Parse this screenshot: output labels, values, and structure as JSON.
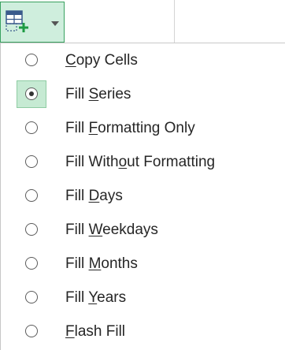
{
  "autofill_button": {
    "icon": "auto-fill-options-icon",
    "caret_icon": "chevron-down-icon",
    "accent_color": "#39a15f",
    "fill_color": "#cfeedd"
  },
  "menu": {
    "selected_index": 1,
    "items": [
      {
        "pre": "",
        "key": "C",
        "post": "opy Cells"
      },
      {
        "pre": "Fill ",
        "key": "S",
        "post": "eries"
      },
      {
        "pre": "Fill ",
        "key": "F",
        "post": "ormatting Only"
      },
      {
        "pre": "Fill With",
        "key": "o",
        "post": "ut Formatting"
      },
      {
        "pre": "Fill ",
        "key": "D",
        "post": "ays"
      },
      {
        "pre": "Fill ",
        "key": "W",
        "post": "eekdays"
      },
      {
        "pre": "Fill ",
        "key": "M",
        "post": "onths"
      },
      {
        "pre": "Fill ",
        "key": "Y",
        "post": "ears"
      },
      {
        "pre": "",
        "key": "F",
        "post": "lash Fill"
      }
    ]
  }
}
